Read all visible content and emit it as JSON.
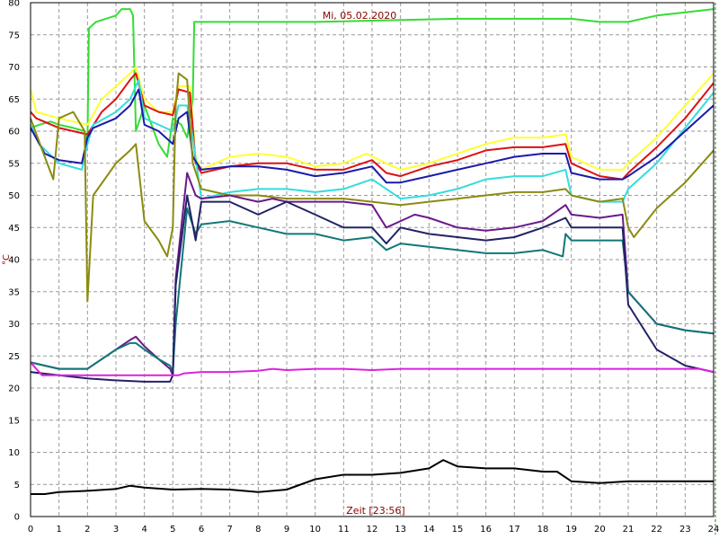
{
  "chart_data": {
    "type": "line",
    "title": "Mi, 05.02.2020",
    "xlabel": "Zeit [23:56]",
    "ylabel": "°C",
    "xlim": [
      0,
      24
    ],
    "ylim": [
      0,
      80
    ],
    "xticks": [
      0,
      1,
      2,
      3,
      4,
      5,
      6,
      7,
      8,
      9,
      10,
      11,
      12,
      13,
      14,
      15,
      16,
      17,
      18,
      19,
      20,
      21,
      22,
      23,
      24
    ],
    "yticks": [
      0,
      5,
      10,
      15,
      20,
      25,
      30,
      35,
      40,
      45,
      50,
      55,
      60,
      65,
      70,
      75,
      80
    ],
    "grid": true,
    "colors": {
      "background": "#ffffff",
      "grid": "#9a9a9a",
      "title": "#8b0000",
      "marker": "#2e7d32"
    },
    "series": [
      {
        "color": "#33dd33",
        "x": [
          0,
          0.3,
          0.7,
          1,
          1.5,
          1.9,
          2,
          2.05,
          2.3,
          3,
          3.2,
          3.5,
          3.6,
          3.7,
          4,
          4.5,
          4.8,
          5,
          5.3,
          5.5,
          5.7,
          5.75,
          6,
          10,
          15,
          17,
          18,
          19,
          20,
          21,
          22,
          23,
          24
        ],
        "y": [
          60.5,
          61,
          61.5,
          61,
          60.5,
          60,
          58,
          76,
          77,
          78,
          79,
          79,
          78,
          60,
          64,
          58,
          56,
          62,
          61,
          59,
          65,
          77,
          77,
          77,
          77.5,
          77.5,
          77.5,
          77.5,
          77,
          77,
          78,
          78.5,
          79
        ]
      },
      {
        "color": "#ffff33",
        "x": [
          0,
          0.2,
          1,
          2,
          2.5,
          3,
          3.5,
          3.7,
          4,
          4.5,
          5,
          5.2,
          5.6,
          5.8,
          6,
          6.5,
          7,
          8,
          9,
          10,
          11,
          11.8,
          12.5,
          13,
          14,
          15,
          16,
          17,
          18,
          18.8,
          19,
          20,
          20.8,
          21,
          22,
          23,
          24
        ],
        "y": [
          66.5,
          63,
          62,
          61,
          65,
          67,
          69,
          70,
          65,
          63,
          63,
          67,
          67,
          56,
          54,
          55,
          56,
          56.5,
          56,
          54.5,
          55,
          56.5,
          55,
          54,
          55,
          56.5,
          58,
          59,
          59,
          59.5,
          56,
          54,
          54,
          55,
          59,
          64,
          69
        ]
      },
      {
        "color": "#dd1111",
        "x": [
          0,
          0.2,
          1,
          2,
          2.5,
          3,
          3.5,
          3.7,
          4,
          4.5,
          5,
          5.2,
          5.6,
          5.8,
          6,
          7,
          8,
          9,
          10,
          11,
          12,
          12.5,
          13,
          14,
          15,
          16,
          17,
          18,
          18.8,
          19,
          20,
          20.8,
          21,
          22,
          23,
          24
        ],
        "y": [
          63,
          62,
          60.5,
          59.5,
          63,
          65,
          68,
          69,
          64,
          63,
          62.5,
          66.5,
          66,
          55,
          53.5,
          54.5,
          55,
          55,
          54,
          54,
          55.5,
          53.5,
          53,
          54.5,
          55.5,
          57,
          57.5,
          57.5,
          58,
          55,
          53,
          52.5,
          53.5,
          57.5,
          62,
          67.5
        ]
      },
      {
        "color": "#33dddd",
        "x": [
          0,
          0.3,
          1,
          1.8,
          2,
          2.2,
          3,
          3.5,
          3.8,
          4,
          4.5,
          5,
          5.2,
          5.5,
          5.7,
          6,
          7,
          8,
          9,
          10,
          11,
          12,
          13,
          14,
          15,
          16,
          17,
          18,
          18.8,
          19,
          20,
          20.8,
          21,
          22,
          23,
          24
        ],
        "y": [
          61,
          58,
          55,
          54,
          58,
          61,
          63,
          65,
          68,
          62,
          61,
          60,
          64,
          64,
          59,
          49.5,
          50.5,
          51,
          51,
          50.5,
          51,
          52.5,
          49.5,
          50,
          51,
          52.5,
          53,
          53,
          54,
          50,
          49,
          49,
          51,
          55,
          60.5,
          66
        ]
      },
      {
        "color": "#1a1aaa",
        "x": [
          0,
          0.5,
          1,
          1.8,
          2,
          2.2,
          3,
          3.5,
          3.8,
          4,
          4.5,
          5,
          5.2,
          5.5,
          5.7,
          6,
          7,
          8,
          9,
          10,
          11,
          12,
          12.5,
          13,
          14,
          15,
          16,
          17,
          18,
          18.8,
          19,
          20,
          20.8,
          21,
          22,
          23,
          24
        ],
        "y": [
          60.5,
          56.5,
          55.5,
          55,
          59,
          60.5,
          62,
          64,
          66.5,
          61,
          60,
          58,
          62,
          63,
          56,
          54,
          54.5,
          54.5,
          54,
          53,
          53.5,
          54.5,
          52,
          52,
          53,
          54,
          55,
          56,
          56.5,
          56.5,
          53.5,
          52.5,
          52.5,
          53,
          56,
          60,
          64
        ]
      },
      {
        "color": "#8b8b11",
        "x": [
          0,
          0.5,
          0.8,
          1,
          1.5,
          1.9,
          2,
          2.2,
          3,
          3.5,
          3.7,
          4,
          4.5,
          4.8,
          5,
          5.1,
          5.2,
          5.5,
          5.7,
          6,
          7,
          8,
          9,
          10,
          11,
          12,
          13,
          14,
          15,
          16,
          17,
          18,
          18.8,
          19,
          20,
          20.8,
          21,
          21.2,
          22,
          23,
          24
        ],
        "y": [
          62,
          56,
          52.5,
          62,
          63,
          60,
          33.5,
          50,
          55,
          57,
          58,
          46,
          43,
          40.5,
          45,
          64,
          69,
          68,
          55,
          51,
          50,
          50,
          49.5,
          49.5,
          49.5,
          49,
          48.5,
          49,
          49.5,
          50,
          50.5,
          50.5,
          51,
          50,
          49,
          49.5,
          45,
          43.5,
          48,
          52,
          57
        ]
      },
      {
        "color": "#6a1a8a",
        "x": [
          0,
          0.5,
          1,
          2,
          3,
          3.5,
          3.7,
          4,
          4.5,
          4.9,
          5,
          5.1,
          5.5,
          5.8,
          6,
          7,
          7.5,
          8,
          8.5,
          9,
          10,
          11,
          12,
          12.5,
          13,
          13.5,
          14,
          15,
          16,
          17,
          18,
          18.8,
          19,
          20,
          20.8,
          21,
          22,
          23,
          24
        ],
        "y": [
          24,
          23.5,
          23,
          23,
          26,
          27.5,
          28,
          26.5,
          24.5,
          23,
          22,
          37,
          53.5,
          50,
          49.5,
          50,
          49.5,
          49,
          49.5,
          49,
          49,
          49,
          48.5,
          45,
          46,
          47,
          46.5,
          45,
          44.5,
          45,
          46,
          48.5,
          47,
          46.5,
          47,
          35,
          30,
          29,
          28.5
        ]
      },
      {
        "color": "#117777",
        "x": [
          0,
          0.5,
          1,
          2,
          3,
          3.5,
          3.7,
          4,
          4.5,
          4.9,
          5,
          5.1,
          5.5,
          5.8,
          6,
          7,
          8,
          9,
          10,
          11,
          12,
          12.5,
          13,
          14,
          15,
          16,
          17,
          18,
          18.7,
          18.8,
          19,
          20,
          20.8,
          21,
          22,
          23,
          24
        ],
        "y": [
          24,
          23.5,
          23,
          23,
          26,
          27,
          27,
          26,
          24.5,
          23.5,
          22.5,
          30,
          48,
          44,
          45.5,
          46,
          45,
          44,
          44,
          43,
          43.5,
          41.5,
          42.5,
          42,
          41.5,
          41,
          41,
          41.5,
          40.5,
          44,
          43,
          43,
          43,
          35,
          30,
          29,
          28.5
        ]
      },
      {
        "color": "#222266",
        "x": [
          0,
          1,
          2,
          3,
          4,
          4.9,
          5,
          5.1,
          5.5,
          5.8,
          6,
          7,
          8,
          9,
          10,
          11,
          12,
          12.5,
          13,
          14,
          15,
          16,
          17,
          18,
          18.8,
          19,
          20,
          20.8,
          21,
          22,
          23,
          24
        ],
        "y": [
          22.5,
          22,
          21.5,
          21.2,
          21,
          21,
          22,
          36,
          50,
          43,
          49,
          49,
          47,
          49,
          47,
          45,
          45,
          42.5,
          45,
          44,
          43.5,
          43,
          43.5,
          45,
          46.5,
          45,
          45,
          45,
          33,
          26,
          23.5,
          22.5
        ]
      },
      {
        "color": "#dd22dd",
        "x": [
          0,
          0.4,
          2,
          4,
          5.2,
          5.4,
          6,
          7,
          8,
          8.5,
          9,
          10,
          11,
          12,
          13,
          14,
          15,
          16,
          17,
          18,
          19,
          20,
          21,
          22,
          23,
          23.5,
          24
        ],
        "y": [
          24,
          22,
          22,
          22,
          22,
          22.3,
          22.5,
          22.5,
          22.7,
          23,
          22.8,
          23,
          23,
          22.8,
          23,
          23,
          23,
          23,
          23,
          23,
          23,
          23,
          23,
          23,
          23,
          23,
          22.5
        ]
      },
      {
        "color": "#000000",
        "x": [
          0,
          0.5,
          1,
          2,
          3,
          3.5,
          4,
          5,
          6,
          7,
          8,
          9,
          10,
          11,
          12,
          13,
          14,
          14.5,
          15,
          16,
          17,
          18,
          18.5,
          19,
          20,
          21,
          22,
          23,
          24
        ],
        "y": [
          3.5,
          3.5,
          3.8,
          4,
          4.3,
          4.8,
          4.5,
          4.2,
          4.3,
          4.2,
          3.8,
          4.2,
          5.8,
          6.5,
          6.5,
          6.8,
          7.5,
          8.8,
          7.8,
          7.5,
          7.5,
          7,
          7,
          5.5,
          5.2,
          5.5,
          5.5,
          5.5,
          5.5
        ]
      }
    ]
  }
}
